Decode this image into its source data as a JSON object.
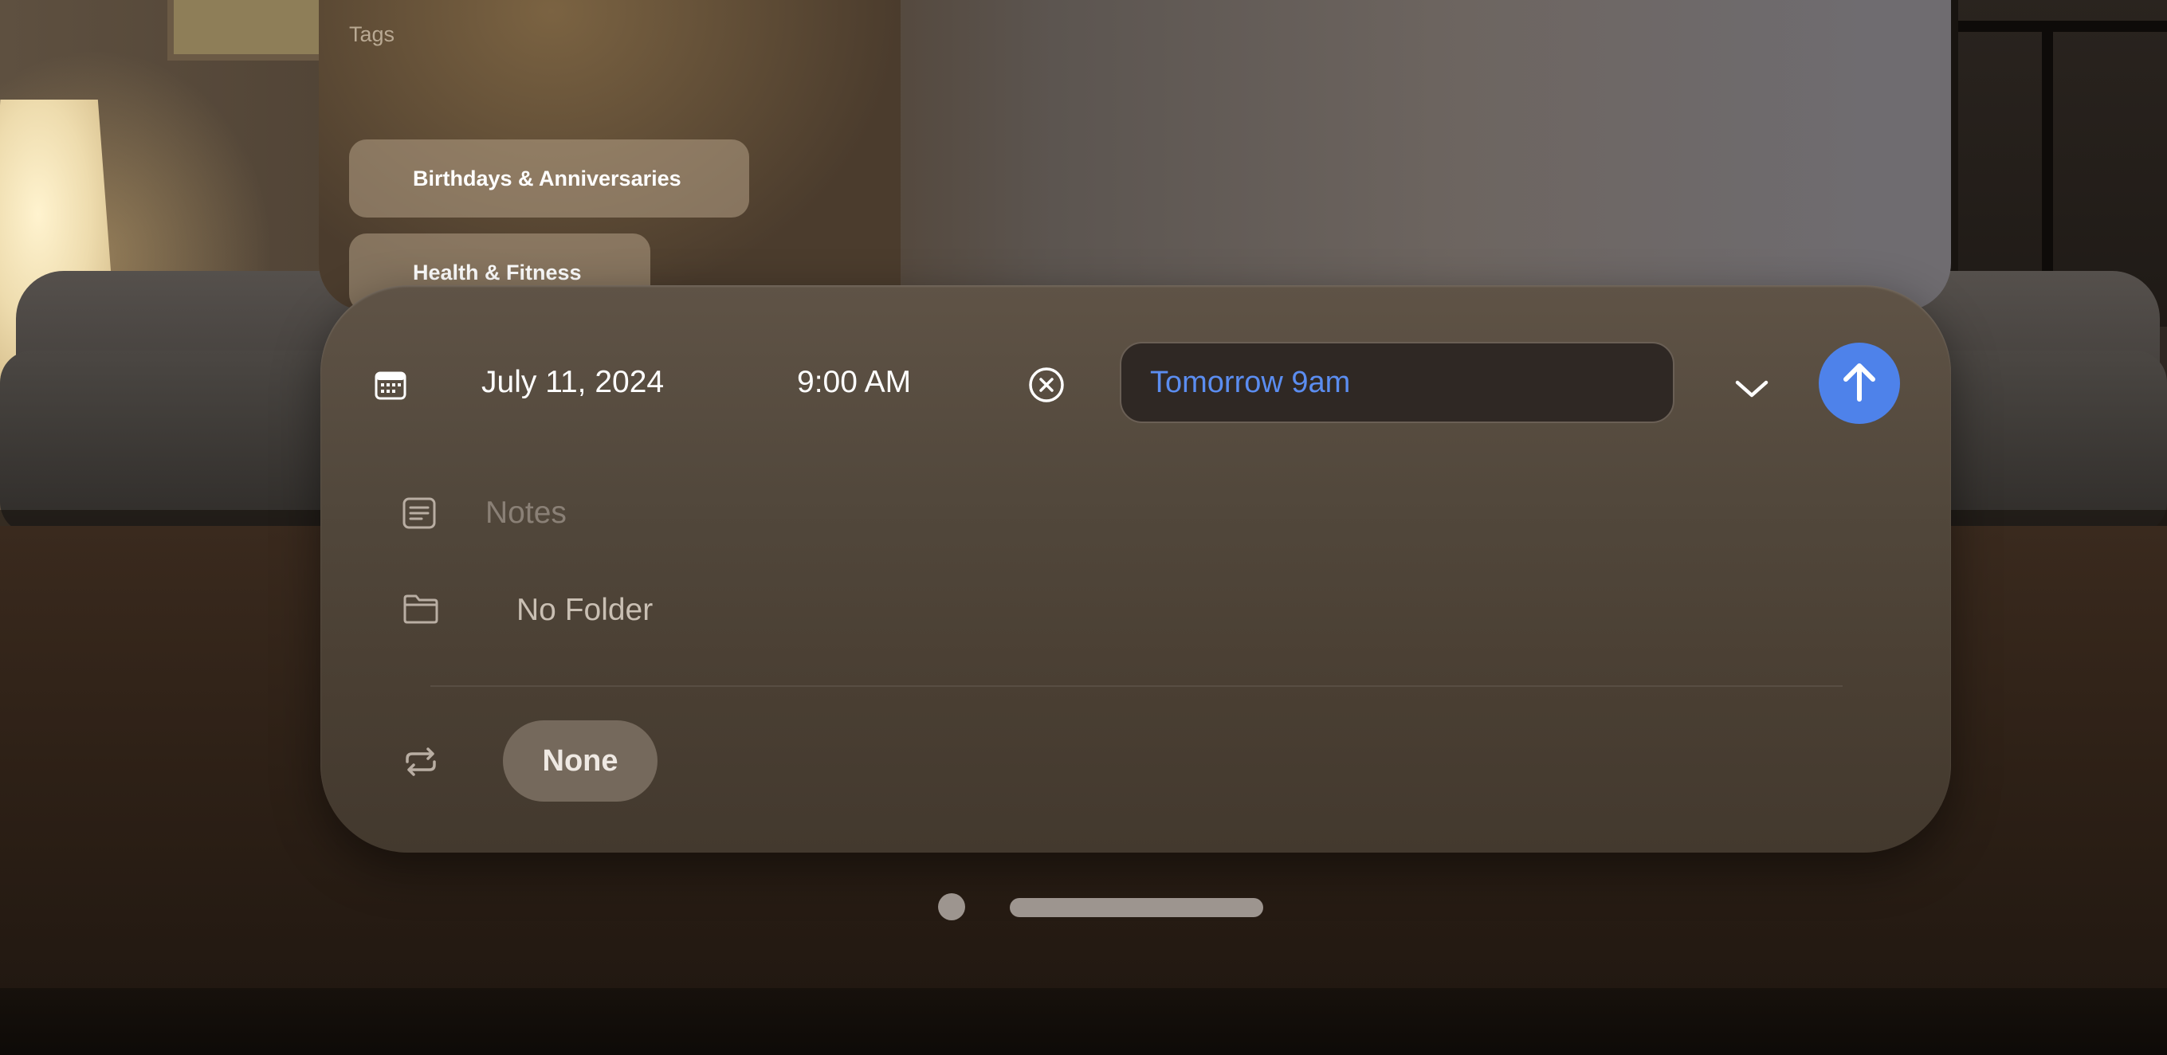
{
  "background_window": {
    "title": "Tags",
    "tags": [
      {
        "label": "Birthdays & Anniversaries"
      },
      {
        "label": "Health & Fitness"
      }
    ]
  },
  "reminder_panel": {
    "date": "July 11, 2024",
    "time": "9:00 AM",
    "date_input_value": "Tomorrow 9am",
    "notes_placeholder": "Notes",
    "folder": "No Folder",
    "repeat": "None",
    "icons": {
      "calendar": "calendar-icon",
      "clear": "clear-circle-x-icon",
      "expand": "chevron-down-icon",
      "submit": "arrow-up-icon",
      "notes": "notes-icon",
      "folder": "folder-icon",
      "repeat": "repeat-icon"
    },
    "colors": {
      "accent": "#4e82ea",
      "input_text": "#5b8df0"
    }
  }
}
